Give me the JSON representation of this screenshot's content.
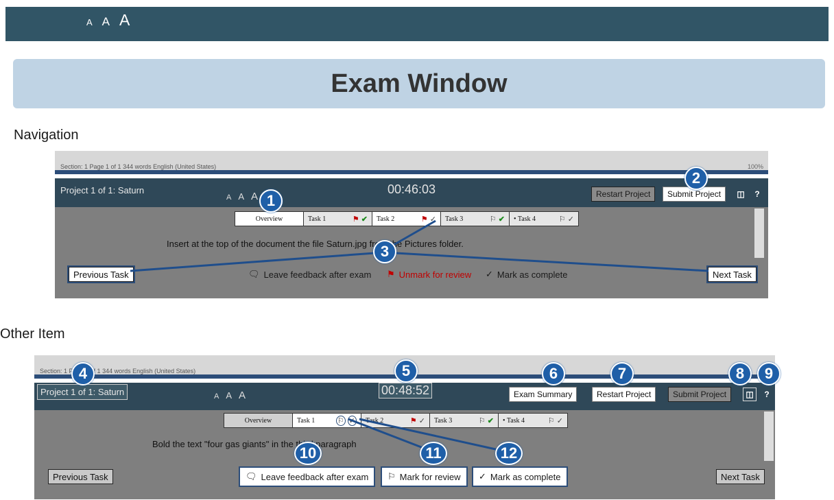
{
  "topbar": {
    "font_sizes": [
      "A",
      "A",
      "A"
    ]
  },
  "title": "Exam Window",
  "sections": {
    "navigation": "Navigation",
    "other": "Other Item"
  },
  "shot1": {
    "status": "Section: 1   Page 1 of 1   344 words   English (United States)",
    "zoom": "100%",
    "project": "Project 1 of 1: Saturn",
    "font_sizes": [
      "A",
      "A",
      "A"
    ],
    "timer": "00:46:03",
    "restart": "Restart Project",
    "submit": "Submit Project",
    "help": "?",
    "tabs": [
      "Overview",
      "Task 1",
      "Task 2",
      "Task 3",
      "• Task 4"
    ],
    "instruction": "Insert at the top of the document the file Saturn.jpg from the Pictures folder.",
    "prev": "Previous Task",
    "next": "Next Task",
    "feedback": "Leave feedback after exam",
    "unmark": "Unmark for review",
    "complete": "Mark as complete",
    "callouts": [
      "1",
      "2",
      "3"
    ]
  },
  "shot2": {
    "status": "Section: 1   Page 1 of 1   344 words   English (United States)",
    "project": "Project 1 of 1: Saturn",
    "font_sizes": [
      "A",
      "A",
      "A"
    ],
    "timer": "00:48:52",
    "summary": "Exam Summary",
    "restart": "Restart Project",
    "submit": "Submit Project",
    "help": "?",
    "tabs": [
      "Overview",
      "Task 1",
      "Task 2",
      "Task 3",
      "• Task 4"
    ],
    "instruction": "Bold the text \"four gas giants\" in the third paragraph",
    "prev": "Previous Task",
    "next": "Next Task",
    "feedback": "Leave feedback after exam",
    "mark_review": "Mark for review",
    "complete": "Mark as complete",
    "callouts": [
      "4",
      "5",
      "6",
      "7",
      "8",
      "9",
      "10",
      "11",
      "12"
    ]
  },
  "colors": {
    "header": "#315566",
    "title_panel": "#bfd3e4",
    "callout": "#1f5fa8",
    "flag": "#c00000",
    "check": "#1c8a1c"
  }
}
